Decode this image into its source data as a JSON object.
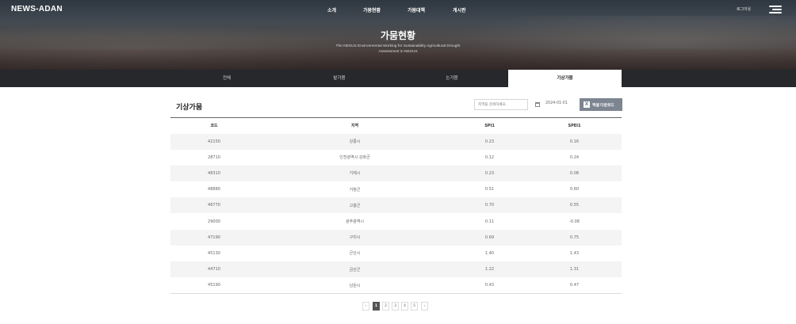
{
  "header": {
    "logo": "NEWS-ADAN",
    "nav": [
      "소개",
      "가뭄현황",
      "가뭄대책",
      "게시판"
    ],
    "login": "로그아웃",
    "menu_icon": "hamburger-menu-icon"
  },
  "hero": {
    "title": "가뭄현황",
    "subtitle_line1": "The NEXUS Environmental Working for Sustainability Agricultural Drought",
    "subtitle_line2": "Assessment in NEXUS"
  },
  "tabs": [
    {
      "label": "전체",
      "active": false
    },
    {
      "label": "밭가뭄",
      "active": false
    },
    {
      "label": "논가뭄",
      "active": false
    },
    {
      "label": "기상가뭄",
      "active": true
    }
  ],
  "section": {
    "title": "기상가뭄",
    "search_placeholder": "지역을 검색하세요.",
    "date": "2024-01-01",
    "excel_label": "엑셀 다운로드",
    "excel_icon": "excel-icon",
    "calendar_icon": "calendar-icon"
  },
  "table": {
    "headers": [
      "코드",
      "지역",
      "SPI1",
      "SPEI1"
    ],
    "rows": [
      [
        "42150",
        "강릉시",
        "0.23",
        "0.16"
      ],
      [
        "28710",
        "인천광역시 강화군",
        "0.12",
        "0.24"
      ],
      [
        "48310",
        "거제시",
        "0.23",
        "0.08"
      ],
      [
        "48880",
        "거창군",
        "0.51",
        "0.60"
      ],
      [
        "46770",
        "고흥군",
        "0.70",
        "0.55"
      ],
      [
        "29000",
        "광주광역시",
        "0.11",
        "-0.08"
      ],
      [
        "47190",
        "구미시",
        "0.69",
        "0.75"
      ],
      [
        "45130",
        "군산시",
        "1.40",
        "1.43"
      ],
      [
        "44710",
        "금산군",
        "1.22",
        "1.31"
      ],
      [
        "45190",
        "남원시",
        "0.43",
        "0.47"
      ]
    ]
  },
  "pagination": {
    "prev": "‹",
    "pages": [
      "1",
      "2",
      "3",
      "4",
      "5"
    ],
    "current": "1",
    "next": "›"
  }
}
